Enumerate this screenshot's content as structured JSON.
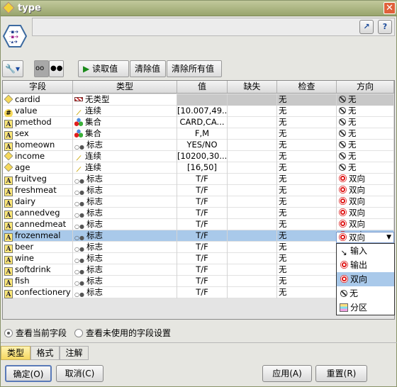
{
  "window": {
    "title": "type",
    "close_icon": "close-icon"
  },
  "toolbar": {
    "read_values": "读取值",
    "clear_values": "清除值",
    "clear_all_values": "清除所有值"
  },
  "columns": [
    "字段",
    "类型",
    "值",
    "缺失",
    "检查",
    "方向"
  ],
  "rows": [
    {
      "field": "cardid",
      "field_icon": "diamond",
      "type": "无类型",
      "type_icon": "typeless",
      "value": "",
      "missing": "",
      "check": "无",
      "direction": "无",
      "dir_icon": "none"
    },
    {
      "field": "value",
      "field_icon": "hash",
      "type": "连续",
      "type_icon": "ruler",
      "value": "[10.007,49...",
      "missing": "",
      "check": "无",
      "direction": "无",
      "dir_icon": "none"
    },
    {
      "field": "pmethod",
      "field_icon": "A",
      "type": "集合",
      "type_icon": "set",
      "value": "CARD,CA...",
      "missing": "",
      "check": "无",
      "direction": "无",
      "dir_icon": "none"
    },
    {
      "field": "sex",
      "field_icon": "A",
      "type": "集合",
      "type_icon": "set",
      "value": "F,M",
      "missing": "",
      "check": "无",
      "direction": "无",
      "dir_icon": "none"
    },
    {
      "field": "homeown",
      "field_icon": "A",
      "type": "标志",
      "type_icon": "flag",
      "value": "YES/NO",
      "missing": "",
      "check": "无",
      "direction": "无",
      "dir_icon": "none"
    },
    {
      "field": "income",
      "field_icon": "diamond",
      "type": "连续",
      "type_icon": "ruler",
      "value": "[10200,30...",
      "missing": "",
      "check": "无",
      "direction": "无",
      "dir_icon": "none"
    },
    {
      "field": "age",
      "field_icon": "diamond",
      "type": "连续",
      "type_icon": "ruler",
      "value": "[16,50]",
      "missing": "",
      "check": "无",
      "direction": "无",
      "dir_icon": "none"
    },
    {
      "field": "fruitveg",
      "field_icon": "A",
      "type": "标志",
      "type_icon": "flag",
      "value": "T/F",
      "missing": "",
      "check": "无",
      "direction": "双向",
      "dir_icon": "both"
    },
    {
      "field": "freshmeat",
      "field_icon": "A",
      "type": "标志",
      "type_icon": "flag",
      "value": "T/F",
      "missing": "",
      "check": "无",
      "direction": "双向",
      "dir_icon": "both"
    },
    {
      "field": "dairy",
      "field_icon": "A",
      "type": "标志",
      "type_icon": "flag",
      "value": "T/F",
      "missing": "",
      "check": "无",
      "direction": "双向",
      "dir_icon": "both"
    },
    {
      "field": "cannedveg",
      "field_icon": "A",
      "type": "标志",
      "type_icon": "flag",
      "value": "T/F",
      "missing": "",
      "check": "无",
      "direction": "双向",
      "dir_icon": "both"
    },
    {
      "field": "cannedmeat",
      "field_icon": "A",
      "type": "标志",
      "type_icon": "flag",
      "value": "T/F",
      "missing": "",
      "check": "无",
      "direction": "双向",
      "dir_icon": "both"
    },
    {
      "field": "frozenmeal",
      "field_icon": "A",
      "type": "标志",
      "type_icon": "flag",
      "value": "T/F",
      "missing": "",
      "check": "无",
      "direction": "双向",
      "dir_icon": "both",
      "selected": true
    },
    {
      "field": "beer",
      "field_icon": "A",
      "type": "标志",
      "type_icon": "flag",
      "value": "T/F",
      "missing": "",
      "check": "无",
      "direction": "",
      "dir_icon": ""
    },
    {
      "field": "wine",
      "field_icon": "A",
      "type": "标志",
      "type_icon": "flag",
      "value": "T/F",
      "missing": "",
      "check": "无",
      "direction": "",
      "dir_icon": ""
    },
    {
      "field": "softdrink",
      "field_icon": "A",
      "type": "标志",
      "type_icon": "flag",
      "value": "T/F",
      "missing": "",
      "check": "无",
      "direction": "",
      "dir_icon": ""
    },
    {
      "field": "fish",
      "field_icon": "A",
      "type": "标志",
      "type_icon": "flag",
      "value": "T/F",
      "missing": "",
      "check": "无",
      "direction": "",
      "dir_icon": ""
    },
    {
      "field": "confectionery",
      "field_icon": "A",
      "type": "标志",
      "type_icon": "flag",
      "value": "T/F",
      "missing": "",
      "check": "无",
      "direction": "",
      "dir_icon": ""
    }
  ],
  "dropdown": {
    "selected": "双向",
    "options": [
      {
        "label": "输入",
        "icon": "input"
      },
      {
        "label": "输出",
        "icon": "target"
      },
      {
        "label": "双向",
        "icon": "both"
      },
      {
        "label": "无",
        "icon": "none"
      },
      {
        "label": "分区",
        "icon": "partition"
      }
    ]
  },
  "view": {
    "current": "查看当前字段",
    "unused": "查看未使用的字段设置"
  },
  "tabs": [
    "类型",
    "格式",
    "注解"
  ],
  "buttons": {
    "ok": "确定(O)",
    "cancel": "取消(C)",
    "apply": "应用(A)",
    "reset": "重置(R)"
  }
}
